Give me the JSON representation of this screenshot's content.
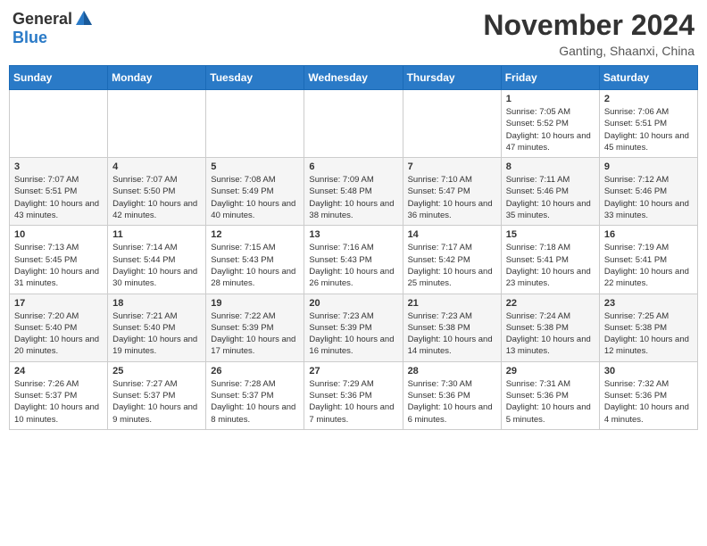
{
  "header": {
    "logo": {
      "general": "General",
      "blue": "Blue"
    },
    "title": "November 2024",
    "location": "Ganting, Shaanxi, China"
  },
  "days_of_week": [
    "Sunday",
    "Monday",
    "Tuesday",
    "Wednesday",
    "Thursday",
    "Friday",
    "Saturday"
  ],
  "weeks": [
    [
      {
        "day": "",
        "info": ""
      },
      {
        "day": "",
        "info": ""
      },
      {
        "day": "",
        "info": ""
      },
      {
        "day": "",
        "info": ""
      },
      {
        "day": "",
        "info": ""
      },
      {
        "day": "1",
        "info": "Sunrise: 7:05 AM\nSunset: 5:52 PM\nDaylight: 10 hours and 47 minutes."
      },
      {
        "day": "2",
        "info": "Sunrise: 7:06 AM\nSunset: 5:51 PM\nDaylight: 10 hours and 45 minutes."
      }
    ],
    [
      {
        "day": "3",
        "info": "Sunrise: 7:07 AM\nSunset: 5:51 PM\nDaylight: 10 hours and 43 minutes."
      },
      {
        "day": "4",
        "info": "Sunrise: 7:07 AM\nSunset: 5:50 PM\nDaylight: 10 hours and 42 minutes."
      },
      {
        "day": "5",
        "info": "Sunrise: 7:08 AM\nSunset: 5:49 PM\nDaylight: 10 hours and 40 minutes."
      },
      {
        "day": "6",
        "info": "Sunrise: 7:09 AM\nSunset: 5:48 PM\nDaylight: 10 hours and 38 minutes."
      },
      {
        "day": "7",
        "info": "Sunrise: 7:10 AM\nSunset: 5:47 PM\nDaylight: 10 hours and 36 minutes."
      },
      {
        "day": "8",
        "info": "Sunrise: 7:11 AM\nSunset: 5:46 PM\nDaylight: 10 hours and 35 minutes."
      },
      {
        "day": "9",
        "info": "Sunrise: 7:12 AM\nSunset: 5:46 PM\nDaylight: 10 hours and 33 minutes."
      }
    ],
    [
      {
        "day": "10",
        "info": "Sunrise: 7:13 AM\nSunset: 5:45 PM\nDaylight: 10 hours and 31 minutes."
      },
      {
        "day": "11",
        "info": "Sunrise: 7:14 AM\nSunset: 5:44 PM\nDaylight: 10 hours and 30 minutes."
      },
      {
        "day": "12",
        "info": "Sunrise: 7:15 AM\nSunset: 5:43 PM\nDaylight: 10 hours and 28 minutes."
      },
      {
        "day": "13",
        "info": "Sunrise: 7:16 AM\nSunset: 5:43 PM\nDaylight: 10 hours and 26 minutes."
      },
      {
        "day": "14",
        "info": "Sunrise: 7:17 AM\nSunset: 5:42 PM\nDaylight: 10 hours and 25 minutes."
      },
      {
        "day": "15",
        "info": "Sunrise: 7:18 AM\nSunset: 5:41 PM\nDaylight: 10 hours and 23 minutes."
      },
      {
        "day": "16",
        "info": "Sunrise: 7:19 AM\nSunset: 5:41 PM\nDaylight: 10 hours and 22 minutes."
      }
    ],
    [
      {
        "day": "17",
        "info": "Sunrise: 7:20 AM\nSunset: 5:40 PM\nDaylight: 10 hours and 20 minutes."
      },
      {
        "day": "18",
        "info": "Sunrise: 7:21 AM\nSunset: 5:40 PM\nDaylight: 10 hours and 19 minutes."
      },
      {
        "day": "19",
        "info": "Sunrise: 7:22 AM\nSunset: 5:39 PM\nDaylight: 10 hours and 17 minutes."
      },
      {
        "day": "20",
        "info": "Sunrise: 7:23 AM\nSunset: 5:39 PM\nDaylight: 10 hours and 16 minutes."
      },
      {
        "day": "21",
        "info": "Sunrise: 7:23 AM\nSunset: 5:38 PM\nDaylight: 10 hours and 14 minutes."
      },
      {
        "day": "22",
        "info": "Sunrise: 7:24 AM\nSunset: 5:38 PM\nDaylight: 10 hours and 13 minutes."
      },
      {
        "day": "23",
        "info": "Sunrise: 7:25 AM\nSunset: 5:38 PM\nDaylight: 10 hours and 12 minutes."
      }
    ],
    [
      {
        "day": "24",
        "info": "Sunrise: 7:26 AM\nSunset: 5:37 PM\nDaylight: 10 hours and 10 minutes."
      },
      {
        "day": "25",
        "info": "Sunrise: 7:27 AM\nSunset: 5:37 PM\nDaylight: 10 hours and 9 minutes."
      },
      {
        "day": "26",
        "info": "Sunrise: 7:28 AM\nSunset: 5:37 PM\nDaylight: 10 hours and 8 minutes."
      },
      {
        "day": "27",
        "info": "Sunrise: 7:29 AM\nSunset: 5:36 PM\nDaylight: 10 hours and 7 minutes."
      },
      {
        "day": "28",
        "info": "Sunrise: 7:30 AM\nSunset: 5:36 PM\nDaylight: 10 hours and 6 minutes."
      },
      {
        "day": "29",
        "info": "Sunrise: 7:31 AM\nSunset: 5:36 PM\nDaylight: 10 hours and 5 minutes."
      },
      {
        "day": "30",
        "info": "Sunrise: 7:32 AM\nSunset: 5:36 PM\nDaylight: 10 hours and 4 minutes."
      }
    ]
  ]
}
